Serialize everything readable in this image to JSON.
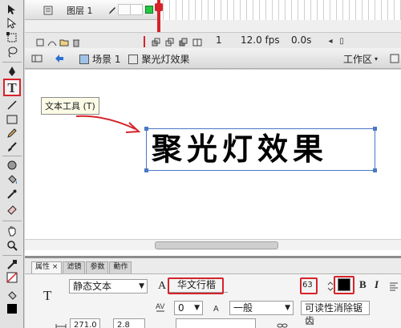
{
  "timeline": {
    "layer_name": "图层 1",
    "frame_number": "1",
    "fps": "12.0 fps",
    "time": "0.0s"
  },
  "edit_bar": {
    "scene": "场景 1",
    "symbol": "聚光灯效果",
    "workspace": "工作区"
  },
  "stage": {
    "text": "聚光灯效果",
    "tooltip": "文本工具 (T)"
  },
  "properties": {
    "tabs": [
      "属性",
      "滤镜",
      "参数",
      "動作"
    ],
    "tab_close": "×",
    "text_type": "静态文本",
    "font_label": "A",
    "font": "华文行楷",
    "font_size": "63",
    "letter_spacing_value": "0",
    "letter_spacing_mode": "一般",
    "antialias": "可读性消除锯齿",
    "x_value": "271.0",
    "y_value": "2.8",
    "big_t": "T"
  },
  "colors": {
    "annotation_red": "#d6232a",
    "selection_blue": "#4a78c4",
    "text_color": "#000000"
  }
}
